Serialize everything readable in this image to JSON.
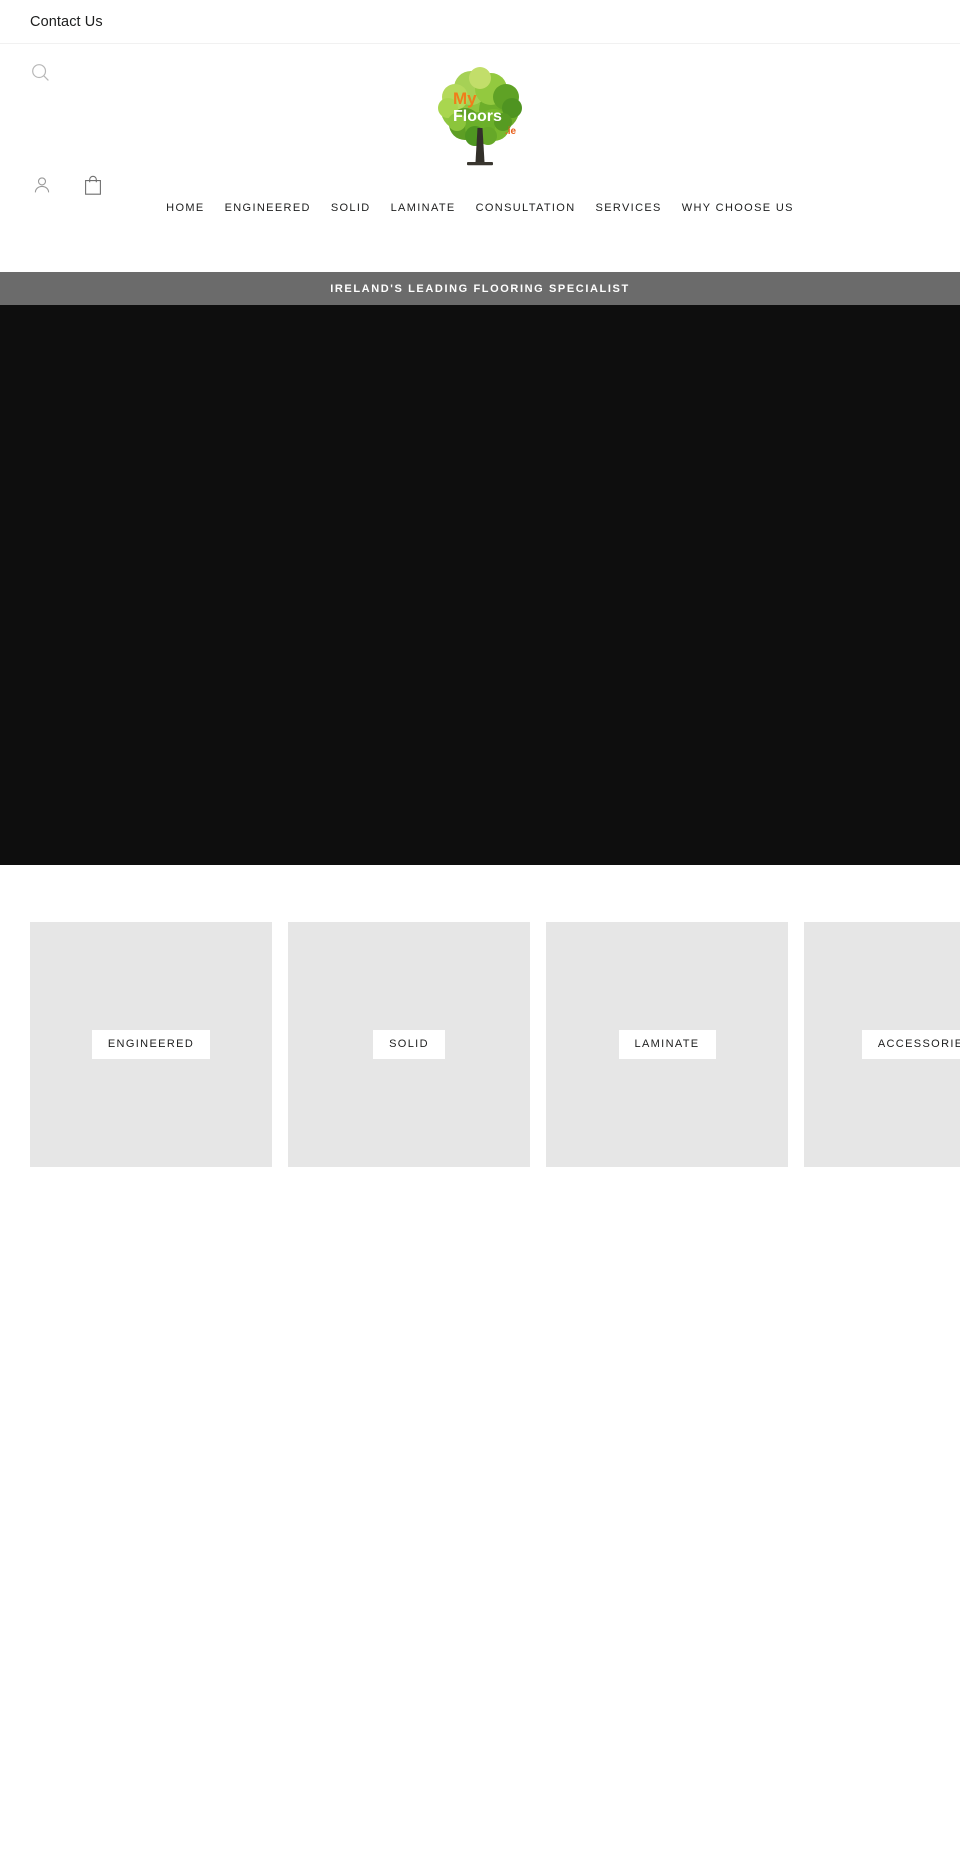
{
  "utility_bar": {
    "contact_label": "Contact Us"
  },
  "header": {
    "search_icon": "search-icon",
    "account_icon": "account-person-icon",
    "cart_icon": "shopping-bag-icon",
    "logo": {
      "alt": "MyFloors.ie",
      "word_my": "My",
      "word_floors": "Floors",
      "word_tld": ".ie",
      "color_my": "#f07d1a",
      "color_floors": "#ffffff",
      "color_tld": "#e8601c",
      "tree_colors": [
        "#8dc63f",
        "#4f9b28",
        "#b9d64a",
        "#6fae31",
        "#d7e35a"
      ],
      "trunk_color": "#2f2a1f"
    },
    "nav": [
      {
        "label": "HOME"
      },
      {
        "label": "ENGINEERED"
      },
      {
        "label": "SOLID"
      },
      {
        "label": "LAMINATE"
      },
      {
        "label": "CONSULTATION"
      },
      {
        "label": "SERVICES"
      },
      {
        "label": "WHY CHOOSE US"
      }
    ]
  },
  "strapline": {
    "text": "IRELAND'S LEADING FLOORING SPECIALIST",
    "background": "#6b6b6b",
    "color": "#ffffff"
  },
  "hero": {
    "background": "#0e0e0e"
  },
  "collection_tiles": [
    {
      "label": "ENGINEERED"
    },
    {
      "label": "SOLID"
    },
    {
      "label": "LAMINATE"
    },
    {
      "label": "ACCESSORIES"
    }
  ],
  "theme": {
    "text_color": "#1c1d1d",
    "tile_placeholder": "#e6e6e6",
    "divider": "#f1f1f1",
    "page_background": "#ffffff"
  }
}
